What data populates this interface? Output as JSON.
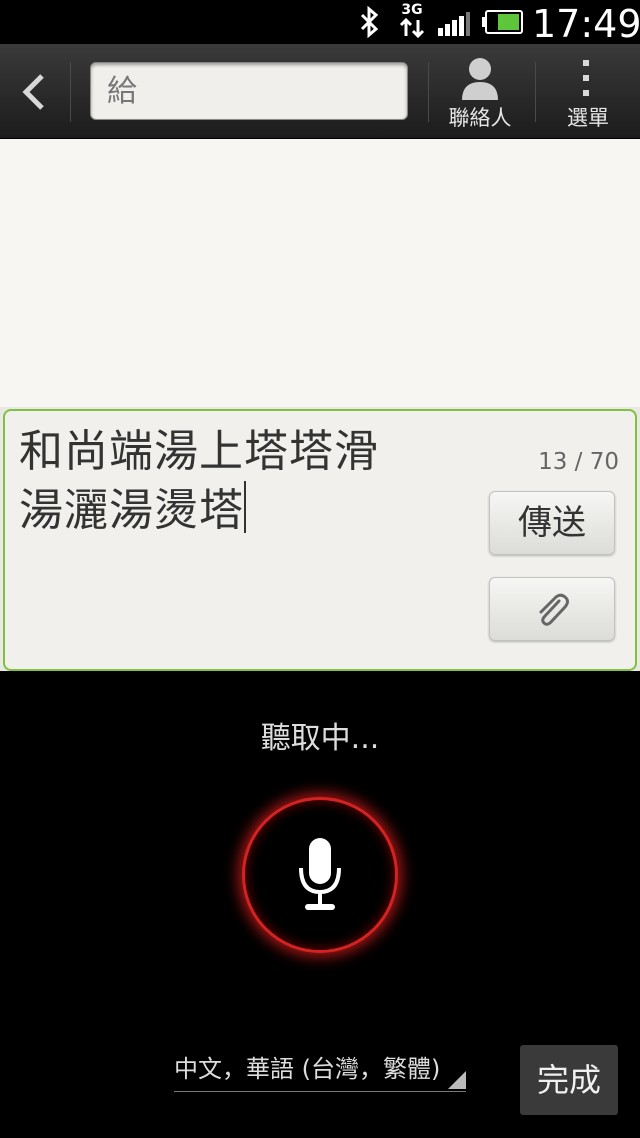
{
  "status_bar": {
    "network": "3G",
    "time": "17:49",
    "icons": [
      "bluetooth-icon",
      "3g-data-icon",
      "signal-icon",
      "battery-icon"
    ]
  },
  "action_bar": {
    "to_placeholder": "給",
    "contacts_label": "聯絡人",
    "menu_label": "選單"
  },
  "composer": {
    "message_line1": "和尚端湯上塔塔滑",
    "message_line2": "湯灑湯燙塔",
    "counter": "13 / 70",
    "send_label": "傳送"
  },
  "voice": {
    "status": "聽取中...",
    "language": "中文，華語 (台灣，繁體)",
    "done_label": "完成"
  },
  "colors": {
    "accent_green": "#7fc243",
    "mic_ring_red": "#d32222"
  }
}
